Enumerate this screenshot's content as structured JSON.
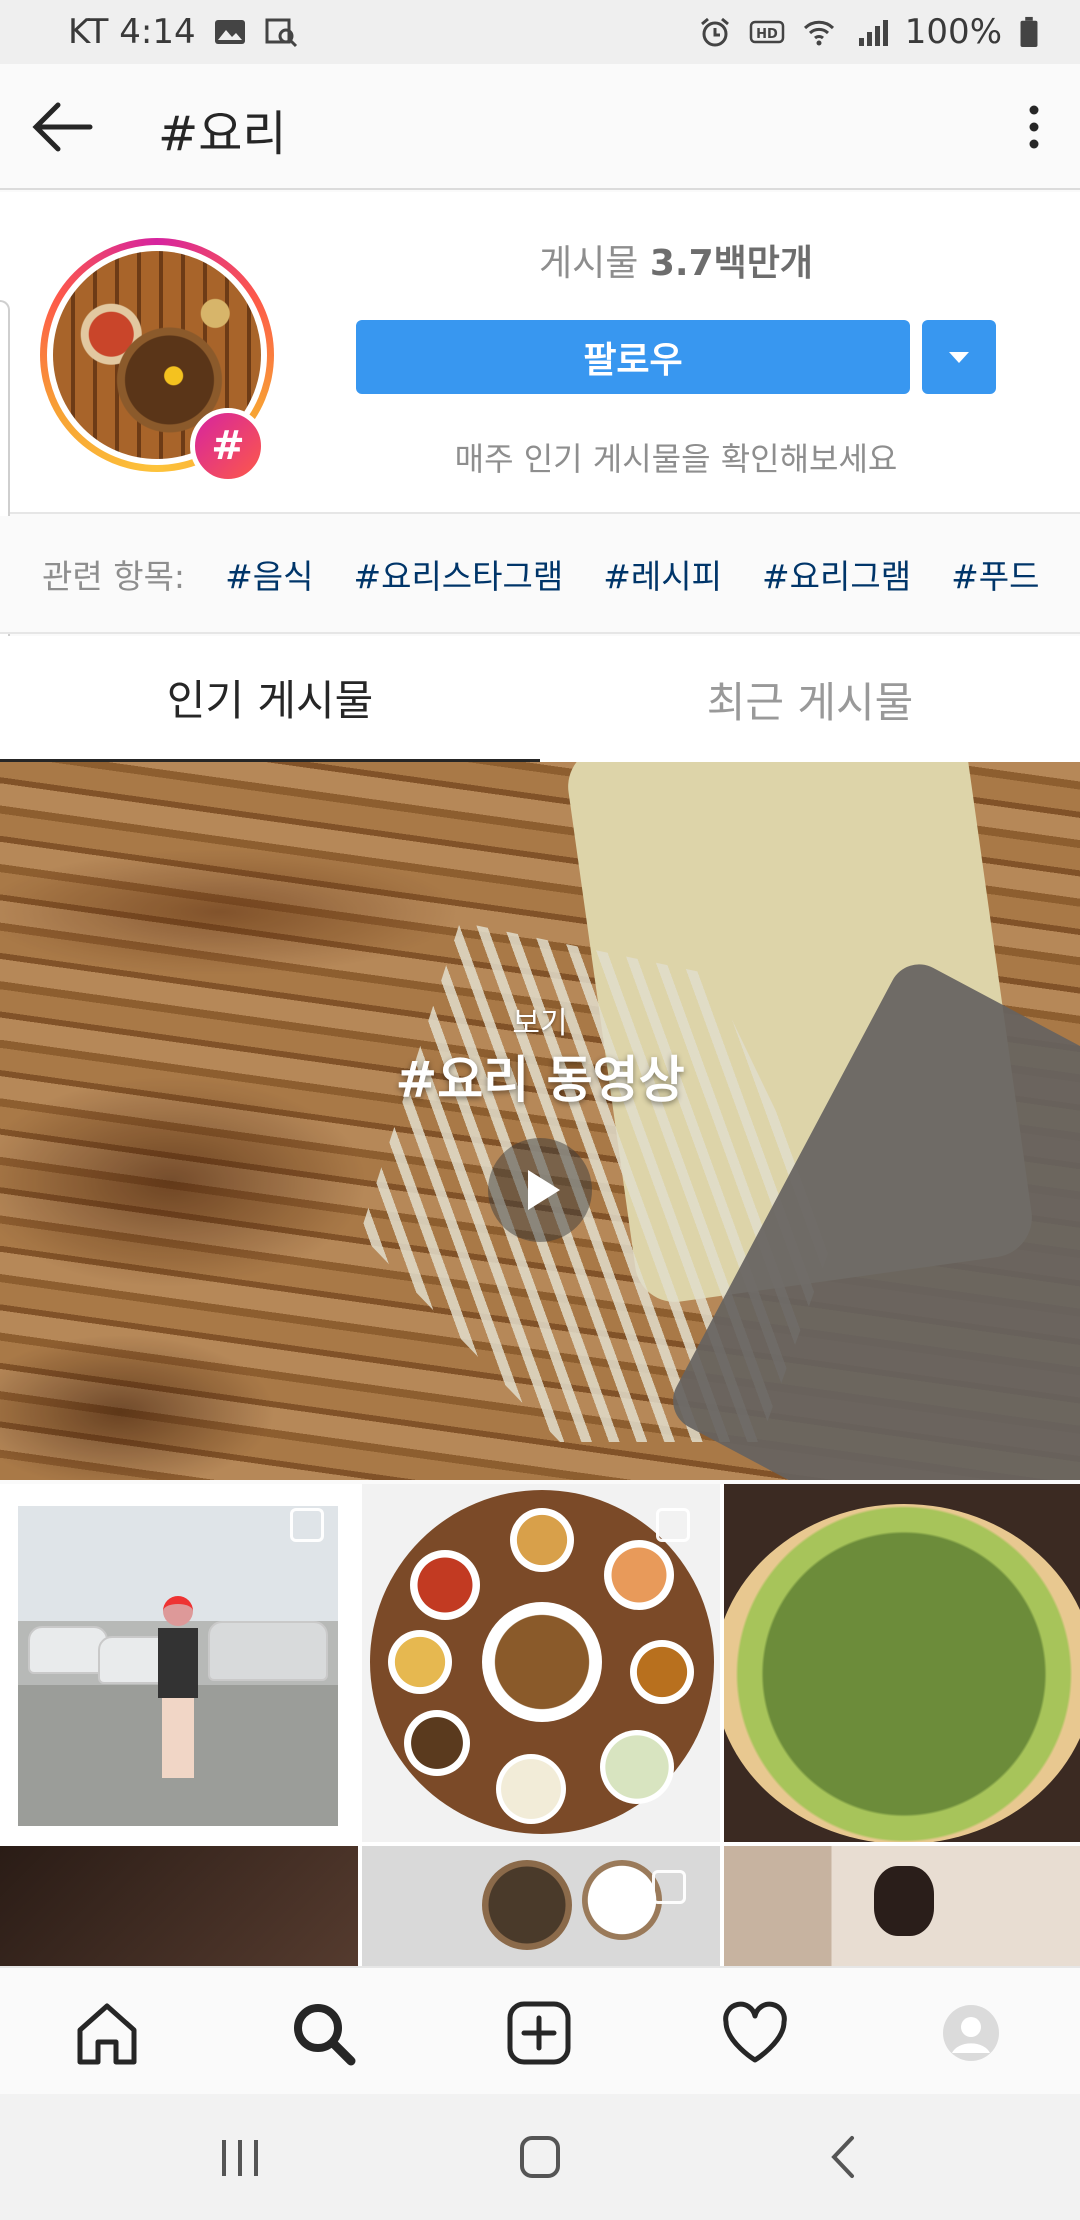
{
  "status_bar": {
    "carrier_time": "KT 4:14",
    "battery": "100%",
    "left_icons": [
      "gallery-icon",
      "search-image-icon"
    ],
    "right_icons": [
      "alarm-icon",
      "hd-icon",
      "wifi-icon",
      "signal-icon",
      "battery-icon"
    ]
  },
  "header": {
    "title": "#요리",
    "back_icon": "arrow-left-icon",
    "menu_icon": "more-vertical-icon"
  },
  "profile": {
    "posts_label": "게시물",
    "posts_count": "3.7백만개",
    "follow_label": "팔로우",
    "weekly_text": "매주 인기 게시물을 확인해보세요",
    "badge": "#"
  },
  "related": {
    "label": "관련 항목:",
    "tags": [
      "#음식",
      "#요리스타그램",
      "#레시피",
      "#요리그램",
      "#푸드",
      "#"
    ]
  },
  "tabs": [
    {
      "label": "인기 게시물",
      "active": true
    },
    {
      "label": "최근 게시물",
      "active": false
    }
  ],
  "video": {
    "small_label": "보기",
    "title": "#요리 동영상"
  },
  "bottom_nav": [
    "home-icon",
    "search-icon",
    "add-post-icon",
    "activity-heart-icon",
    "profile-avatar-icon"
  ],
  "system_nav": [
    "recent-apps-icon",
    "home-button-icon",
    "back-button-icon"
  ],
  "colors": {
    "accent": "#3897f0",
    "tag": "#003569",
    "muted": "#8e8e8e"
  }
}
